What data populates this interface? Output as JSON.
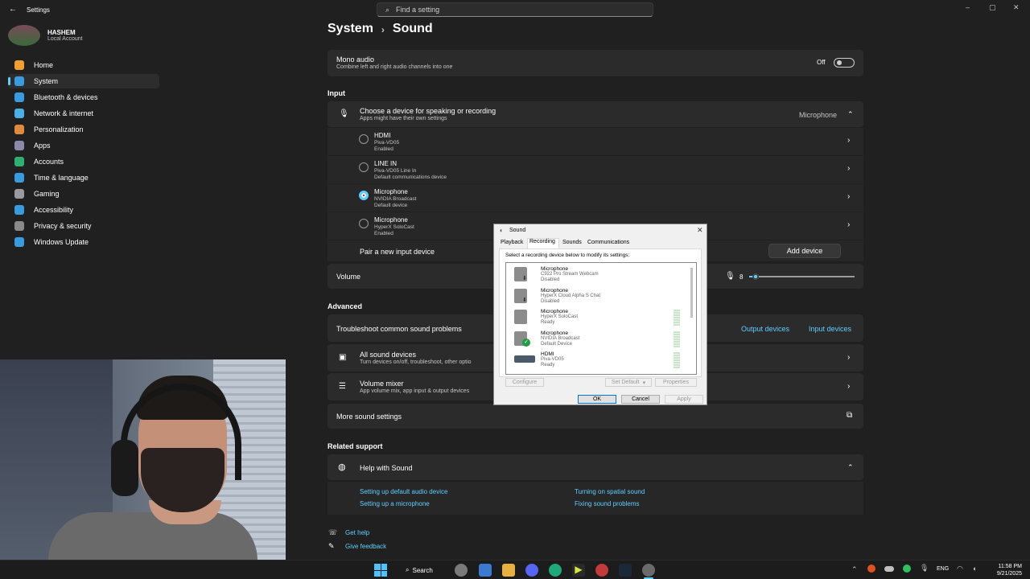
{
  "window": {
    "title": "Settings"
  },
  "search": {
    "placeholder": "Find a setting"
  },
  "user": {
    "name": "HASHEM",
    "account": "Local Account"
  },
  "sidebar": {
    "items": [
      {
        "label": "Home",
        "color": "#f0a030"
      },
      {
        "label": "System",
        "color": "#3a9be0"
      },
      {
        "label": "Bluetooth & devices",
        "color": "#3a9be0"
      },
      {
        "label": "Network & internet",
        "color": "#4ab0e8"
      },
      {
        "label": "Personalization",
        "color": "#e08a40"
      },
      {
        "label": "Apps",
        "color": "#8a8aa8"
      },
      {
        "label": "Accounts",
        "color": "#30b070"
      },
      {
        "label": "Time & language",
        "color": "#3a9be0"
      },
      {
        "label": "Gaming",
        "color": "#9a9aa0"
      },
      {
        "label": "Accessibility",
        "color": "#3a9be0"
      },
      {
        "label": "Privacy & security",
        "color": "#8a8a8a"
      },
      {
        "label": "Windows Update",
        "color": "#3a9be0"
      }
    ]
  },
  "breadcrumb": {
    "parent": "System",
    "separator": "›",
    "current": "Sound"
  },
  "mono": {
    "title": "Mono audio",
    "desc": "Combine left and right audio channels into one",
    "state": "Off"
  },
  "input": {
    "heading": "Input",
    "choose_title": "Choose a device for speaking or recording",
    "choose_desc": "Apps might have their own settings",
    "selected": "Microphone",
    "devices": [
      {
        "name": "HDMI",
        "sub": "Piva-VD05",
        "status": "Enabled",
        "selected": false
      },
      {
        "name": "LINE IN",
        "sub": "Piva-VD05 Line In",
        "status": "Default communications device",
        "selected": false
      },
      {
        "name": "Microphone",
        "sub": "NVIDIA Broadcast",
        "status": "Default device",
        "selected": true
      },
      {
        "name": "Microphone",
        "sub": "HyperX SoloCast",
        "status": "Enabled",
        "selected": false
      }
    ],
    "pair_label": "Pair a new input device",
    "add_button": "Add device",
    "volume_label": "Volume",
    "volume_value": "8"
  },
  "advanced": {
    "heading": "Advanced",
    "troubleshoot": "Troubleshoot common sound problems",
    "output_devices": "Output devices",
    "input_devices": "Input devices",
    "all_title": "All sound devices",
    "all_desc": "Turn devices on/off, troubleshoot, other optio",
    "mixer_title": "Volume mixer",
    "mixer_desc": "App volume mix, app input & output devices",
    "more": "More sound settings"
  },
  "support": {
    "heading": "Related support",
    "help_title": "Help with Sound",
    "links": [
      "Setting up default audio device",
      "Turning on spatial sound",
      "Setting up a microphone",
      "Fixing sound problems"
    ]
  },
  "footer": {
    "get_help": "Get help",
    "feedback": "Give feedback"
  },
  "dialog": {
    "title": "Sound",
    "tabs": [
      "Playback",
      "Recording",
      "Sounds",
      "Communications"
    ],
    "instruction": "Select a recording device below to modify its settings:",
    "devices": [
      {
        "name": "Microphone",
        "sub": "C922 Pro Stream Webcam",
        "status": "Disabled"
      },
      {
        "name": "Microphone",
        "sub": "HyperX Cloud Alpha S Chat",
        "status": "Disabled"
      },
      {
        "name": "Microphone",
        "sub": "HyperX SoloCast",
        "status": "Ready"
      },
      {
        "name": "Microphone",
        "sub": "NVIDIA Broadcast",
        "status": "Default Device"
      },
      {
        "name": "HDMI",
        "sub": "Piva-VD05",
        "status": "Ready"
      }
    ],
    "configure": "Configure",
    "set_default": "Set Default",
    "properties": "Properties",
    "ok": "OK",
    "cancel": "Cancel",
    "apply": "Apply"
  },
  "taskbar": {
    "search": "Search",
    "lang": "ENG",
    "time": "11:58 PM",
    "date": "9/21/2025"
  },
  "colors": {
    "accent": "#60cdff",
    "background": "#202020",
    "card": "#2b2b2b"
  }
}
